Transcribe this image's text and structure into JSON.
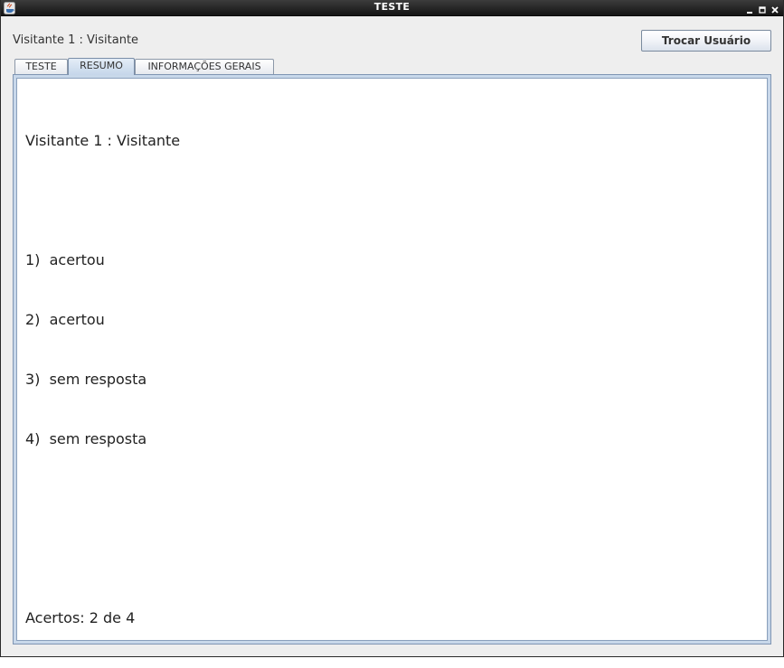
{
  "window": {
    "title": "TESTE"
  },
  "header": {
    "user_label": "Visitante 1 : Visitante",
    "switch_user_button": "Trocar Usuário"
  },
  "tabs": [
    {
      "label": "TESTE",
      "selected": false
    },
    {
      "label": "RESUMO",
      "selected": true
    },
    {
      "label": "INFORMAÇÕES GERAIS",
      "selected": false
    }
  ],
  "summary": {
    "user_line": "Visitante 1 : Visitante",
    "answers": [
      "1)  acertou",
      "2)  acertou",
      "3)  sem resposta",
      "4)  sem resposta"
    ],
    "score_line": "Acertos: 2 de 4"
  },
  "colors": {
    "titlebar": "#1e1e1e",
    "window_bg": "#eeeeee",
    "selected_tab": "#c5d6ea",
    "content_border": "#7f95b3"
  },
  "icons": [
    "java-app-icon",
    "minimize-icon",
    "maximize-icon",
    "close-icon"
  ]
}
